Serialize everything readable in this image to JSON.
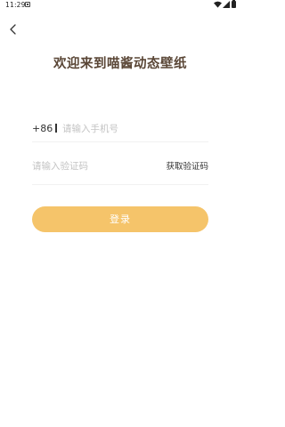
{
  "status_bar": {
    "time": "11:29"
  },
  "header": {
    "title": "欢迎来到喵酱动态壁纸"
  },
  "form": {
    "country_code": "+86",
    "phone_placeholder": "请输入手机号",
    "code_placeholder": "请输入验证码",
    "get_code_label": "获取验证码",
    "login_label": "登录"
  },
  "colors": {
    "accent": "#f5c46a",
    "title": "#5a4636",
    "placeholder": "#c4c4c4"
  },
  "icons": {
    "back": "chevron-left-icon",
    "notification": "notification-icon",
    "wifi": "wifi-icon",
    "signal": "signal-icon",
    "battery": "battery-icon"
  }
}
